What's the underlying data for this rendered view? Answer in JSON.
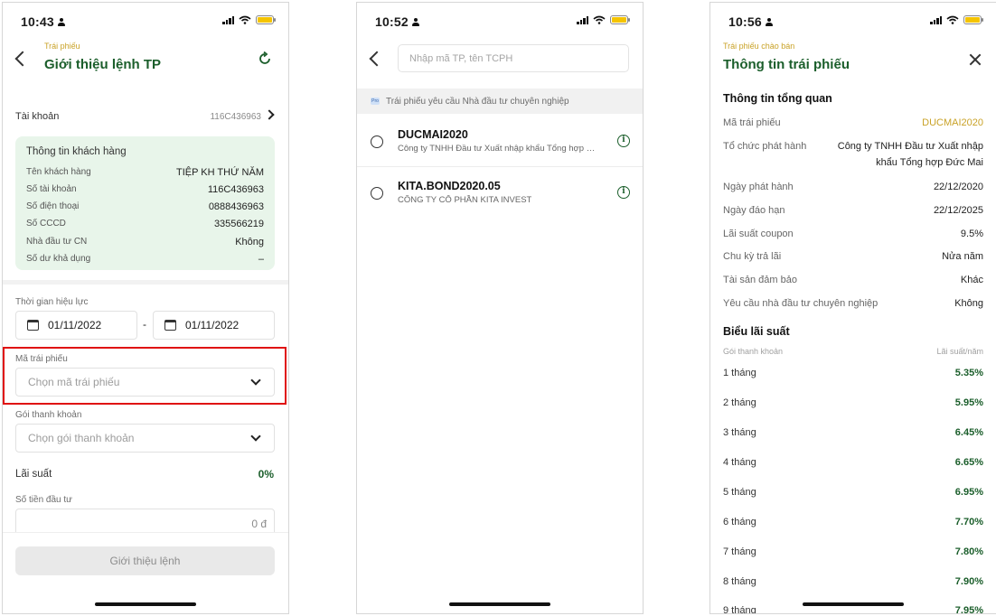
{
  "colors": {
    "brand_green": "#1b5e2b",
    "gold": "#c9a227",
    "highlight_red": "#e01010",
    "info_bg": "#e8f5ea"
  },
  "screen1": {
    "time": "10:43",
    "breadcrumb": "Trái phiếu",
    "title": "Giới thiệu lệnh TP",
    "account_label": "Tài khoản",
    "account_value": "116C436963",
    "customer_box_title": "Thông tin khách hàng",
    "customer_rows": [
      {
        "label": "Tên khách hàng",
        "value": "TIỆP KH THỨ NĂM"
      },
      {
        "label": "Số tài khoản",
        "value": "116C436963"
      },
      {
        "label": "Số điện thoại",
        "value": "0888436963"
      },
      {
        "label": "Số CCCD",
        "value": "335566219"
      },
      {
        "label": "Nhà đầu tư CN",
        "value": "Không"
      },
      {
        "label": "Số dư khả dụng",
        "value": "–"
      }
    ],
    "validity_label": "Thời gian hiệu lực",
    "date_from": "01/11/2022",
    "date_separator": "-",
    "date_to": "01/11/2022",
    "bond_code_label": "Mã trái phiếu",
    "bond_code_placeholder": "Chọn mã trái phiếu",
    "package_label": "Gói thanh khoản",
    "package_placeholder": "Chọn gói thanh khoản",
    "rate_label": "Lãi suất",
    "rate_value": "0%",
    "amount_label": "Số tiền đầu tư",
    "amount_value": "0 đ",
    "submit_label": "Giới thiệu lệnh"
  },
  "screen2": {
    "time": "10:52",
    "search_placeholder": "Nhập mã TP, tên TCPH",
    "pro_icon_text": "Pro",
    "banner_text": "Trái phiếu yêu cầu Nhà đầu tư chuyên nghiệp",
    "bonds": [
      {
        "code": "DUCMAI2020",
        "issuer": "Công ty TNHH Đầu tư Xuất nhập khẩu Tổng hợp Đức Mai"
      },
      {
        "code": "KITA.BOND2020.05",
        "issuer": "CÔNG TY CỔ PHẦN KITA INVEST"
      }
    ]
  },
  "screen3": {
    "time": "10:56",
    "breadcrumb": "Trái phiếu chào bán",
    "title": "Thông tin trái phiếu",
    "overview_title": "Thông tin tổng quan",
    "bond_code_label": "Mã trái phiếu",
    "bond_code_value": "DUCMAI2020",
    "issuer_label": "Tổ chức phát hành",
    "issuer_line1": "Công ty TNHH Đầu tư Xuất nhập",
    "issuer_line2": "khẩu Tổng hợp Đức Mai",
    "details": [
      {
        "label": "Ngày phát hành",
        "value": "22/12/2020"
      },
      {
        "label": "Ngày đáo hạn",
        "value": "22/12/2025"
      },
      {
        "label": "Lãi suất coupon",
        "value": "9.5%"
      },
      {
        "label": "Chu kỳ trả lãi",
        "value": "Nửa năm"
      },
      {
        "label": "Tài sản đảm bảo",
        "value": "Khác"
      },
      {
        "label": "Yêu cầu nhà đầu tư chuyên nghiệp",
        "value": "Không"
      }
    ],
    "rate_table_title": "Biểu lãi suất",
    "rate_col_package": "Gói thanh khoản",
    "rate_col_rate": "Lãi suất/năm",
    "rates": [
      {
        "term": "1 tháng",
        "rate": "5.35%"
      },
      {
        "term": "2 tháng",
        "rate": "5.95%"
      },
      {
        "term": "3 tháng",
        "rate": "6.45%"
      },
      {
        "term": "4 tháng",
        "rate": "6.65%"
      },
      {
        "term": "5 tháng",
        "rate": "6.95%"
      },
      {
        "term": "6 tháng",
        "rate": "7.70%"
      },
      {
        "term": "7 tháng",
        "rate": "7.80%"
      },
      {
        "term": "8 tháng",
        "rate": "7.90%"
      },
      {
        "term": "9 tháng",
        "rate": "7.95%"
      }
    ]
  }
}
